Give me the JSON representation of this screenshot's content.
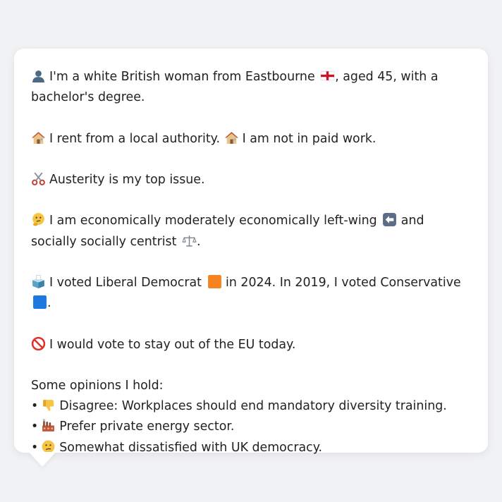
{
  "persona": {
    "intro": {
      "icon": "person-silhouette-icon",
      "text_before_flag": "I'm a white British woman from Eastbourne",
      "flag_icon": "england-flag-icon",
      "text_after_flag": ", aged 45, with a bachelor's degree."
    },
    "housing": {
      "icon": "house-icon",
      "rent_text": "I rent from a local authority.",
      "work_icon": "house-icon",
      "work_text": "I am not in paid work."
    },
    "issue": {
      "icon": "scissors-icon",
      "text": "Austerity is my top issue."
    },
    "ideology": {
      "icon": "thinking-face-icon",
      "text_before": "I am economically moderately economically left-wing",
      "left_icon": "left-arrow-icon",
      "text_middle": "and socially socially centrist",
      "scale_icon": "balance-scale-icon",
      "text_end": "."
    },
    "votes": {
      "icon": "ballot-box-icon",
      "text_before": "I voted Liberal Democrat",
      "libdem_icon": "orange-square-icon",
      "text_middle": "in 2024. In 2019, I voted Conservative",
      "con_icon": "blue-square-icon",
      "text_end": "."
    },
    "eu": {
      "icon": "prohibited-icon",
      "text": "I would vote to stay out of the EU today."
    },
    "opinions": {
      "heading": "Some opinions I hold:",
      "bullet": "•",
      "items": [
        {
          "icon": "thumbs-down-icon",
          "text": "Disagree: Workplaces should end mandatory diversity training."
        },
        {
          "icon": "factory-icon",
          "text": "Prefer private energy sector."
        },
        {
          "icon": "confused-face-icon",
          "text": "Somewhat dissatisfied with UK democracy."
        }
      ]
    }
  },
  "colors": {
    "background": "#f1f2f4",
    "card": "#ffffff",
    "text": "#222222"
  }
}
